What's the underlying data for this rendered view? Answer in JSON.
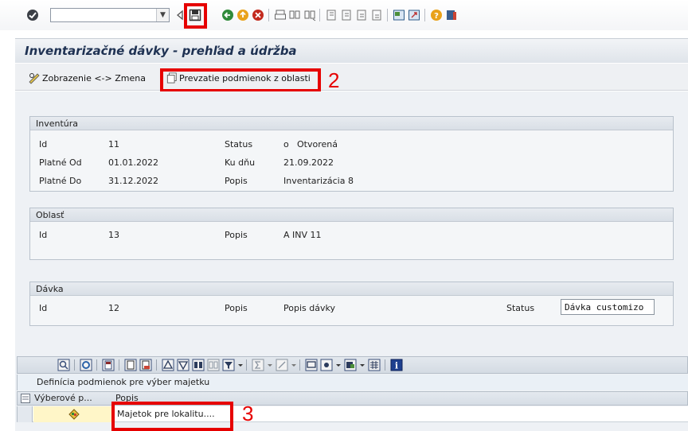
{
  "toolbar": {
    "command_value": "",
    "icons": [
      "check-icon",
      "save-icon",
      "back-icon",
      "exit-icon",
      "cancel-icon",
      "print-icon",
      "find-icon",
      "find-next-icon",
      "first-page-icon",
      "prev-page-icon",
      "next-page-icon",
      "last-page-icon",
      "new-session-icon",
      "shortcut-icon",
      "help-icon",
      "customize-layout-icon"
    ]
  },
  "header": {
    "title": "Inventarizačné dávky - prehľad a údržba"
  },
  "app_toolbar": {
    "display_change": "Zobrazenie <-> Zmena",
    "take_conditions": "Prevzatie podmienok z oblasti"
  },
  "annotations": {
    "two": "2",
    "three": "3"
  },
  "inventura": {
    "title": "Inventúra",
    "id_label": "Id",
    "id_value": "11",
    "status_label": "Status",
    "status_value": "Otvorená",
    "status_mark": "o",
    "valid_from_label": "Platné Od",
    "valid_from": "01.01.2022",
    "to_day_label": "Ku dňu",
    "to_day": "21.09.2022",
    "valid_to_label": "Platné Do",
    "valid_to": "31.12.2022",
    "desc_label": "Popis",
    "desc_value": "Inventarizácia 8"
  },
  "oblast": {
    "title": "Oblasť",
    "id_label": "Id",
    "id_value": "13",
    "desc_label": "Popis",
    "desc_value": "A INV 11"
  },
  "davka": {
    "title": "Dávka",
    "id_label": "Id",
    "id_value": "12",
    "desc_label": "Popis",
    "desc_value": "Popis dávky",
    "status_label": "Status",
    "status_value": "Dávka customizo"
  },
  "grid": {
    "caption": "Definícia podmienok pre výber majetku",
    "columns": [
      "Výberové p...",
      "Popis"
    ],
    "rows": [
      {
        "desc": "Majetok pre lokalitu...."
      }
    ]
  },
  "colors": {
    "highlight": "#e60000",
    "title": "#1e3152",
    "row_yellow": "#fff6c8"
  }
}
